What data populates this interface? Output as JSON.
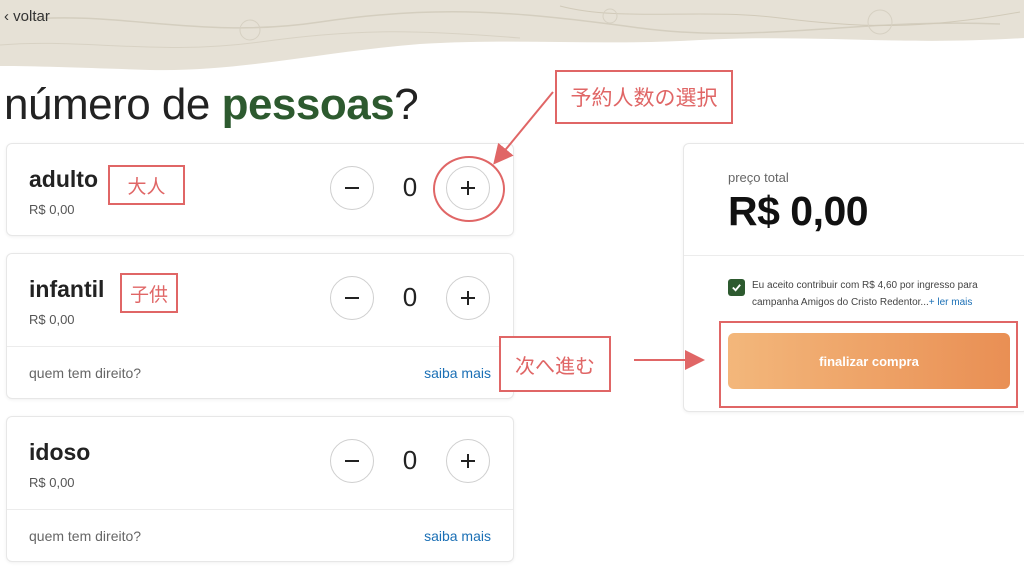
{
  "nav": {
    "back_label": "‹ voltar"
  },
  "title": {
    "prefix": "número de ",
    "highlight": "pessoas",
    "suffix": "?"
  },
  "categories": [
    {
      "name": "adulto",
      "price": "R$ 0,00",
      "quantity": "0"
    },
    {
      "name": "infantil",
      "price": "R$ 0,00",
      "quantity": "0",
      "who_label": "quem tem direito?",
      "more_label": "saiba mais"
    },
    {
      "name": "idoso",
      "price": "R$ 0,00",
      "quantity": "0",
      "who_label": "quem tem direito?",
      "more_label": "saiba mais"
    }
  ],
  "summary": {
    "total_label": "preço total",
    "total_value": "R$ 0,00",
    "consent_checked": true,
    "consent_text": "Eu aceito contribuir com R$ 4,60 por ingresso para campanha Amigos do Cristo Redentor...",
    "consent_more": "+ ler mais",
    "buy_label": "finalizar compra"
  },
  "annotations": {
    "select_count": "予約人数の選択",
    "adult": "大人",
    "child": "子供",
    "next": "次へ進む"
  },
  "colors": {
    "accent_green": "#2d5a2f",
    "link_blue": "#1a6fb5",
    "button_gradient_start": "#f3b77b",
    "button_gradient_end": "#e98f54",
    "annotation_red": "#e06666"
  }
}
